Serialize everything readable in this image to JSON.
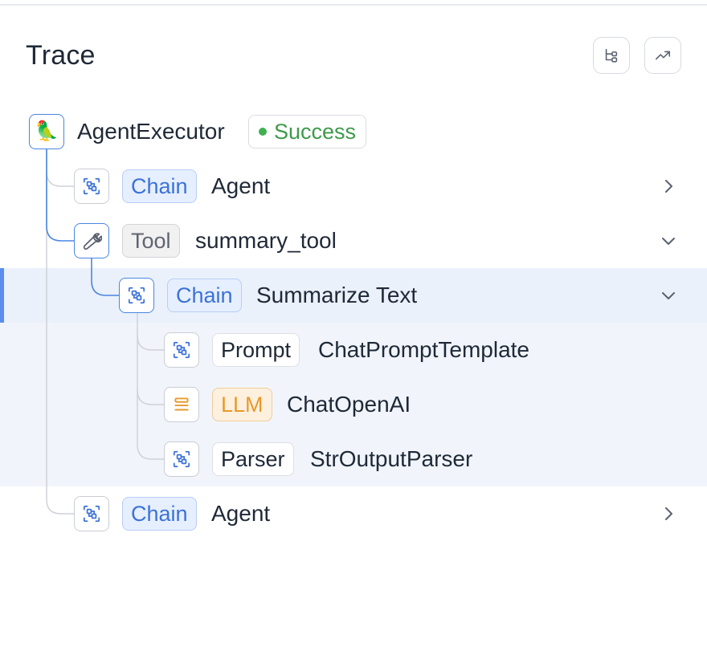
{
  "header": {
    "title": "Trace",
    "buttons": [
      {
        "icon": "tree-view-icon"
      },
      {
        "icon": "trend-chart-icon"
      }
    ]
  },
  "colors": {
    "chain": "#3c72d8",
    "llm": "#e89a2b",
    "success": "#3e9a4a",
    "selected_accent": "#5b8def"
  },
  "trace": {
    "root": {
      "name": "AgentExecutor",
      "status": "Success",
      "icon": "parrot-icon"
    },
    "rows": [
      {
        "type_label": "Chain",
        "name": "Agent",
        "chevron": "right"
      },
      {
        "type_label": "Tool",
        "name": "summary_tool",
        "chevron": "down"
      },
      {
        "type_label": "Chain",
        "name": "Summarize Text",
        "chevron": "down",
        "selected": true
      },
      {
        "type_label": "Prompt",
        "name": "ChatPromptTemplate"
      },
      {
        "type_label": "LLM",
        "name": "ChatOpenAI"
      },
      {
        "type_label": "Parser",
        "name": "StrOutputParser"
      },
      {
        "type_label": "Chain",
        "name": "Agent",
        "chevron": "right"
      }
    ]
  }
}
